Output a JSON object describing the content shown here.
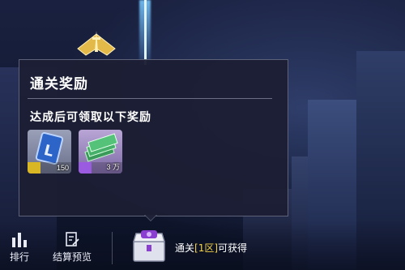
{
  "popup": {
    "title": "通关奖励",
    "subtitle": "达成后可领取以下奖励",
    "rewards": [
      {
        "icon": "blue-card-icon",
        "quantity": "150",
        "rarity_color": "#d9b624"
      },
      {
        "icon": "cash-stack-icon",
        "quantity": "3 万",
        "rarity_color": "#9b5be0"
      }
    ]
  },
  "bottom_bar": {
    "rank_label": "排行",
    "preview_label": "结算预览",
    "clear_prefix": "通关",
    "clear_zone": "[1区]",
    "clear_suffix": "可获得"
  }
}
